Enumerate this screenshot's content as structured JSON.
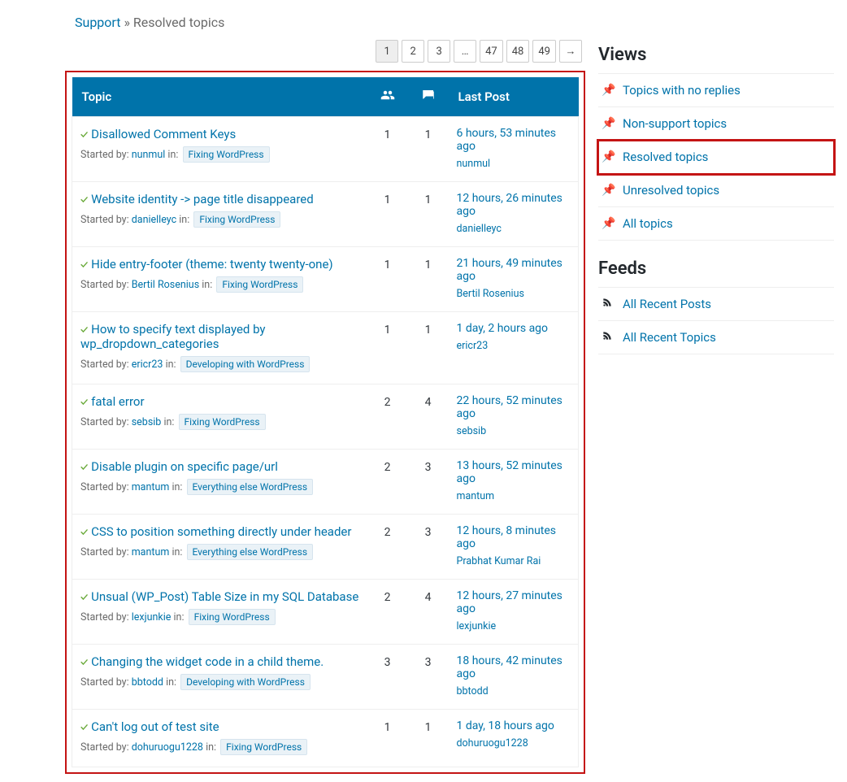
{
  "breadcrumb": {
    "support": "Support",
    "sep": "»",
    "current": "Resolved topics"
  },
  "pagination": [
    "1",
    "2",
    "3",
    "…",
    "47",
    "48",
    "49",
    "→"
  ],
  "table_head": {
    "topic": "Topic",
    "voices_icon": "voices",
    "replies_icon": "replies",
    "last_post": "Last Post"
  },
  "topics": [
    {
      "title": "Disallowed Comment Keys",
      "started_prefix": "Started by: ",
      "user": "nunmul",
      "in_label": "in: ",
      "forum": "Fixing WordPress",
      "voices": "1",
      "replies": "1",
      "last_time": "6 hours, 53 minutes ago",
      "last_user": "nunmul"
    },
    {
      "title": "Website identity -> page title disappeared",
      "started_prefix": "Started by: ",
      "user": "danielleyc",
      "in_label": "in: ",
      "forum": "Fixing WordPress",
      "voices": "1",
      "replies": "1",
      "last_time": "12 hours, 26 minutes ago",
      "last_user": "danielleyc"
    },
    {
      "title": "Hide entry-footer (theme: twenty twenty-one)",
      "started_prefix": "Started by: ",
      "user": "Bertil Rosenius",
      "in_label": "in: ",
      "forum": "Fixing WordPress",
      "voices": "1",
      "replies": "1",
      "last_time": "21 hours, 49 minutes ago",
      "last_user": "Bertil Rosenius"
    },
    {
      "title": "How to specify text displayed by wp_dropdown_categories",
      "started_prefix": "Started by: ",
      "user": "ericr23",
      "in_label": "in: ",
      "forum": "Developing with WordPress",
      "voices": "1",
      "replies": "1",
      "last_time": "1 day, 2 hours ago",
      "last_user": "ericr23"
    },
    {
      "title": "fatal error",
      "started_prefix": "Started by: ",
      "user": "sebsib",
      "in_label": "in: ",
      "forum": "Fixing WordPress",
      "voices": "2",
      "replies": "4",
      "last_time": "22 hours, 52 minutes ago",
      "last_user": "sebsib"
    },
    {
      "title": "Disable plugin on specific page/url",
      "started_prefix": "Started by: ",
      "user": "mantum",
      "in_label": "in: ",
      "forum": "Everything else WordPress",
      "voices": "2",
      "replies": "3",
      "last_time": "13 hours, 52 minutes ago",
      "last_user": "mantum"
    },
    {
      "title": "CSS to position something directly under header",
      "started_prefix": "Started by: ",
      "user": "mantum",
      "in_label": "in: ",
      "forum": "Everything else WordPress",
      "voices": "2",
      "replies": "3",
      "last_time": "12 hours, 8 minutes ago",
      "last_user": "Prabhat Kumar Rai"
    },
    {
      "title": "Unsual (WP_Post) Table Size in my SQL Database",
      "started_prefix": "Started by: ",
      "user": "lexjunkie",
      "in_label": "in: ",
      "forum": "Fixing WordPress",
      "voices": "2",
      "replies": "4",
      "last_time": "12 hours, 27 minutes ago",
      "last_user": "lexjunkie"
    },
    {
      "title": "Changing the widget code in a child theme.",
      "started_prefix": "Started by: ",
      "user": "bbtodd",
      "in_label": "in: ",
      "forum": "Developing with WordPress",
      "voices": "3",
      "replies": "3",
      "last_time": "18 hours, 42 minutes ago",
      "last_user": "bbtodd"
    },
    {
      "title": "Can't log out of test site",
      "started_prefix": "Started by: ",
      "user": "dohuruogu1228",
      "in_label": "in: ",
      "forum": "Fixing WordPress",
      "voices": "1",
      "replies": "1",
      "last_time": "1 day, 18 hours ago",
      "last_user": "dohuruogu1228"
    }
  ],
  "sidebar": {
    "views_heading": "Views",
    "views": [
      {
        "label": "Topics with no replies",
        "highlight": false
      },
      {
        "label": "Non-support topics",
        "highlight": false
      },
      {
        "label": "Resolved topics",
        "highlight": true
      },
      {
        "label": "Unresolved topics",
        "highlight": false
      },
      {
        "label": "All topics",
        "highlight": false
      }
    ],
    "feeds_heading": "Feeds",
    "feeds": [
      {
        "label": "All Recent Posts"
      },
      {
        "label": "All Recent Topics"
      }
    ]
  }
}
